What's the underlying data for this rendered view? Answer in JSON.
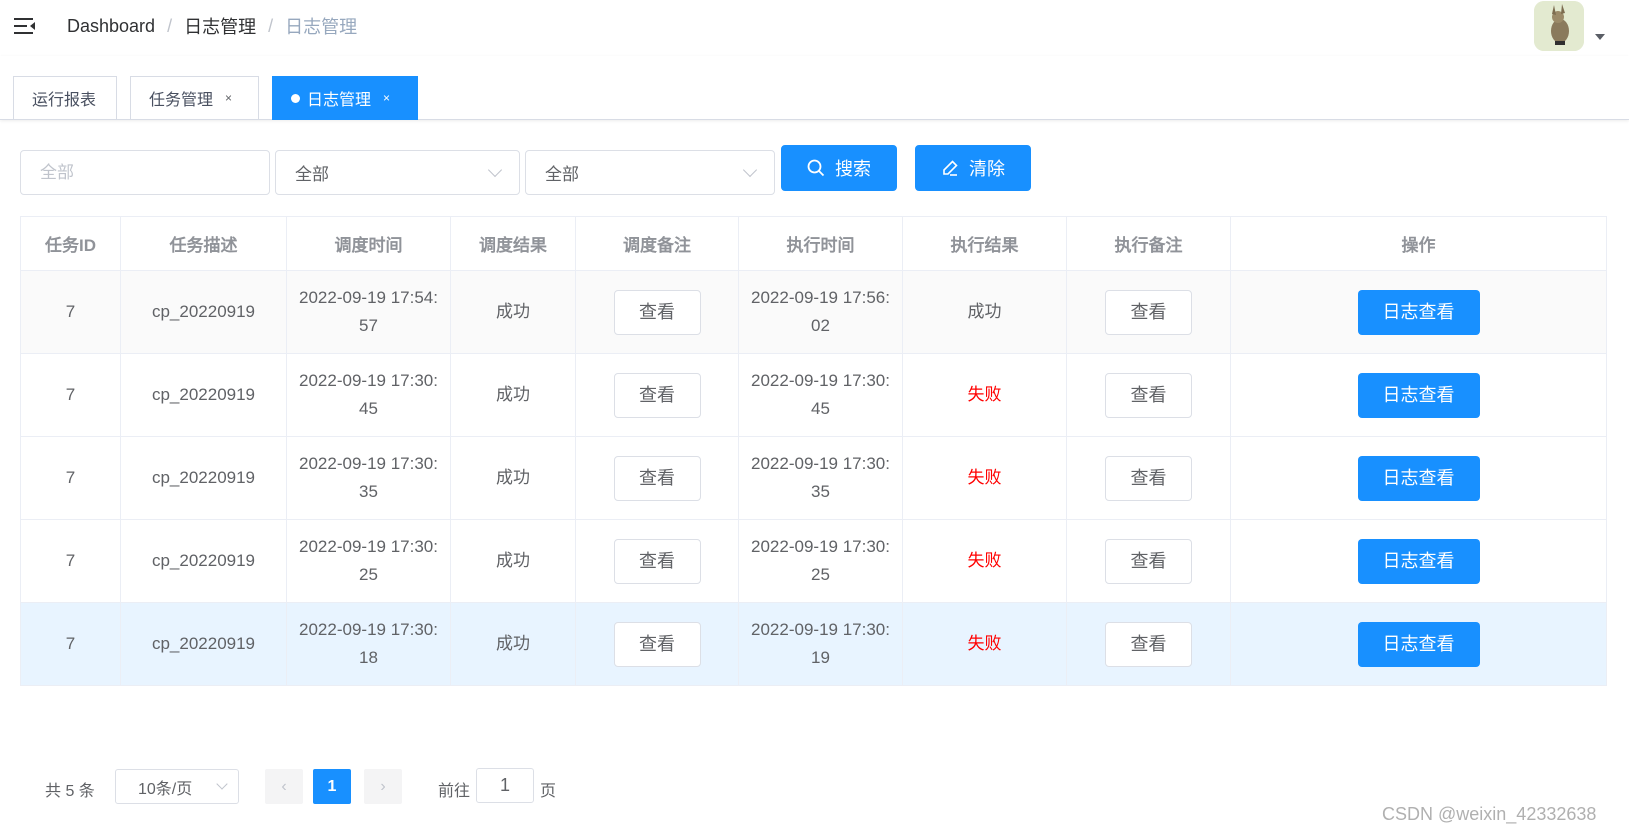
{
  "navbar": {
    "breadcrumb": [
      "Dashboard",
      "日志管理",
      "日志管理"
    ],
    "breadcrumb_separator": "/"
  },
  "tags": [
    {
      "label": "运行报表",
      "closable": false,
      "active": false
    },
    {
      "label": "任务管理",
      "closable": true,
      "active": false
    },
    {
      "label": "日志管理",
      "closable": true,
      "active": true
    }
  ],
  "tag_close_glyph": "×",
  "filters": {
    "job_input_placeholder": "全部",
    "select1_value": "全部",
    "select2_value": "全部",
    "search_label": "搜索",
    "clear_label": "清除"
  },
  "table": {
    "columns": [
      "任务ID",
      "任务描述",
      "调度时间",
      "调度结果",
      "调度备注",
      "执行时间",
      "执行结果",
      "执行备注",
      "操作"
    ],
    "rows": [
      {
        "id": "7",
        "desc": "cp_20220919",
        "trigger_time": "2022-09-19 17:54:57",
        "trigger_result": "成功",
        "trigger_note": "查看",
        "handle_time": "2022-09-19 17:56:02",
        "handle_result": "成功",
        "handle_result_status": "success",
        "handle_note": "查看",
        "action": "日志查看"
      },
      {
        "id": "7",
        "desc": "cp_20220919",
        "trigger_time": "2022-09-19 17:30:45",
        "trigger_result": "成功",
        "trigger_note": "查看",
        "handle_time": "2022-09-19 17:30:45",
        "handle_result": "失败",
        "handle_result_status": "fail",
        "handle_note": "查看",
        "action": "日志查看"
      },
      {
        "id": "7",
        "desc": "cp_20220919",
        "trigger_time": "2022-09-19 17:30:35",
        "trigger_result": "成功",
        "trigger_note": "查看",
        "handle_time": "2022-09-19 17:30:35",
        "handle_result": "失败",
        "handle_result_status": "fail",
        "handle_note": "查看",
        "action": "日志查看"
      },
      {
        "id": "7",
        "desc": "cp_20220919",
        "trigger_time": "2022-09-19 17:30:25",
        "trigger_result": "成功",
        "trigger_note": "查看",
        "handle_time": "2022-09-19 17:30:25",
        "handle_result": "失败",
        "handle_result_status": "fail",
        "handle_note": "查看",
        "action": "日志查看"
      },
      {
        "id": "7",
        "desc": "cp_20220919",
        "trigger_time": "2022-09-19 17:30:18",
        "trigger_result": "成功",
        "trigger_note": "查看",
        "handle_time": "2022-09-19 17:30:19",
        "handle_result": "失败",
        "handle_result_status": "fail",
        "handle_note": "查看",
        "action": "日志查看"
      }
    ]
  },
  "pagination": {
    "total_text": "共 5 条",
    "page_size": "10条/页",
    "prev_glyph": "‹",
    "next_glyph": "›",
    "current_page": "1",
    "goto_label": "前往",
    "goto_value": "1",
    "page_suffix": "页"
  },
  "watermark": "CSDN @weixin_42332638",
  "colors": {
    "primary": "#1890ff",
    "fail": "#ff0000",
    "hover_row": "#e8f4ff"
  }
}
